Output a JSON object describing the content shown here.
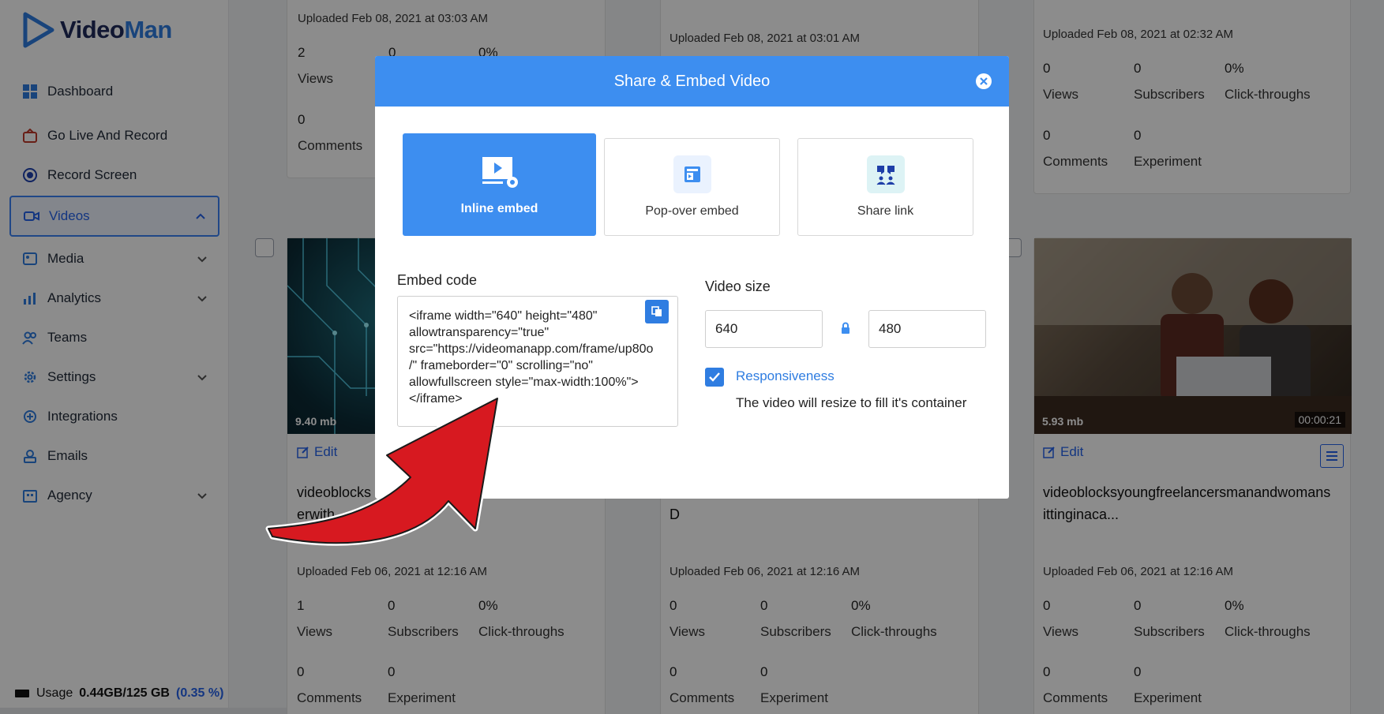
{
  "app": {
    "name_part1": "Video",
    "name_part2": "Man"
  },
  "sidebar": {
    "items": [
      {
        "label": "Dashboard"
      },
      {
        "label": "Go Live And Record"
      },
      {
        "label": "Record Screen"
      },
      {
        "label": "Videos"
      },
      {
        "label": "Media"
      },
      {
        "label": "Analytics"
      },
      {
        "label": "Teams"
      },
      {
        "label": "Settings"
      },
      {
        "label": "Integrations"
      },
      {
        "label": "Emails"
      },
      {
        "label": "Agency"
      }
    ],
    "usage": {
      "label": "Usage",
      "value": "0.44GB/125 GB",
      "percent": "(0.35 %)"
    }
  },
  "cards_top": [
    {
      "uploaded": "Uploaded Feb 08, 2021 at 03:03 AM",
      "views": "2",
      "subscribers": "0",
      "ctr": "0%",
      "views_label": "Views",
      "comments": "0",
      "comments_label": "Comments"
    },
    {
      "uploaded": "Uploaded Feb 08, 2021 at 03:01 AM"
    },
    {
      "uploaded": "Uploaded Feb 08, 2021 at 02:32 AM",
      "views": "0",
      "subscribers": "0",
      "ctr": "0%",
      "views_label": "Views",
      "subscribers_label": "Subscribers",
      "ctr_label": "Click-throughs",
      "comments": "0",
      "experiment": "0",
      "comments_label": "Comments",
      "experiment_label": "Experiment"
    }
  ],
  "cards_bottom": [
    {
      "size": "9.40 mb",
      "edit": "Edit",
      "title_a": "videoblocks",
      "title_b": "erwith...",
      "uploaded": "Uploaded Feb 06, 2021 at 12:16 AM",
      "views": "1",
      "subscribers": "0",
      "ctr": "0%",
      "views_label": "Views",
      "subscribers_label": "Subscribers",
      "ctr_label": "Click-throughs",
      "comments": "0",
      "experiment": "0",
      "comments_label": "Comments",
      "experiment_label": "Experiment"
    },
    {
      "title_b": "D",
      "uploaded": "Uploaded Feb 06, 2021 at 12:16 AM",
      "views": "0",
      "subscribers": "0",
      "ctr": "0%",
      "views_label": "Views",
      "subscribers_label": "Subscribers",
      "ctr_label": "Click-throughs",
      "comments": "0",
      "experiment": "0",
      "comments_label": "Comments",
      "experiment_label": "Experiment"
    },
    {
      "size": "5.93 mb",
      "duration": "00:00:21",
      "edit": "Edit",
      "title_a": "videoblocksyoungfreelancersmanandwomans",
      "title_b": "ittinginaca...",
      "uploaded": "Uploaded Feb 06, 2021 at 12:16 AM",
      "views": "0",
      "subscribers": "0",
      "ctr": "0%",
      "views_label": "Views",
      "subscribers_label": "Subscribers",
      "ctr_label": "Click-throughs",
      "comments": "0",
      "experiment": "0",
      "comments_label": "Comments",
      "experiment_label": "Experiment"
    }
  ],
  "modal": {
    "title": "Share & Embed Video",
    "options": [
      {
        "label": "Inline embed",
        "icon": "inline-embed-icon"
      },
      {
        "label": "Pop-over embed",
        "icon": "popover-embed-icon"
      },
      {
        "label": "Share link",
        "icon": "share-link-icon"
      }
    ],
    "embed_label": "Embed code",
    "embed_code": "<iframe width=\"640\" height=\"480\"\nallowtransparency=\"true\"\nsrc=\"https://videomanapp.com/frame/up80o\n/\" frameborder=\"0\" scrolling=\"no\"\nallowfullscreen style=\"max-width:100%\">\n</iframe>",
    "size_label": "Video size",
    "width": "640",
    "height": "480",
    "responsive_label": "Responsiveness",
    "responsive_desc": "The video will resize to fill it's container"
  },
  "colors": {
    "primary": "#3d8ef0",
    "accent": "#2f7de1",
    "arrow": "#d71920"
  }
}
